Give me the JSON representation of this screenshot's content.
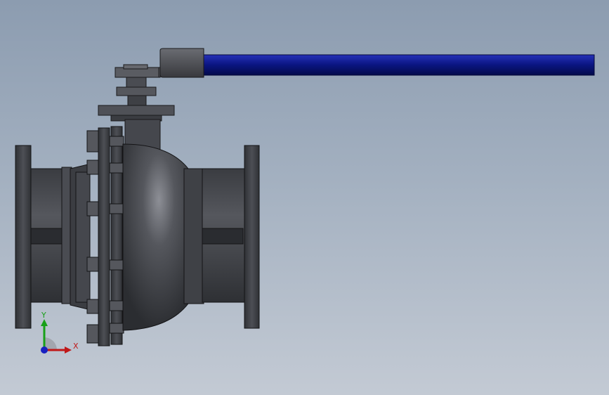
{
  "scene": {
    "model": "ball-valve",
    "colors": {
      "background_top": "#8c9cb0",
      "background_bottom": "#c3cad4",
      "body": "#4a4c52",
      "edge": "#1a1a1c",
      "handle": "#0a1580"
    }
  },
  "triad": {
    "x_label": "X",
    "y_label": "Y",
    "x_color": "#c01818",
    "y_color": "#18a018",
    "z_color": "#1820c0"
  }
}
